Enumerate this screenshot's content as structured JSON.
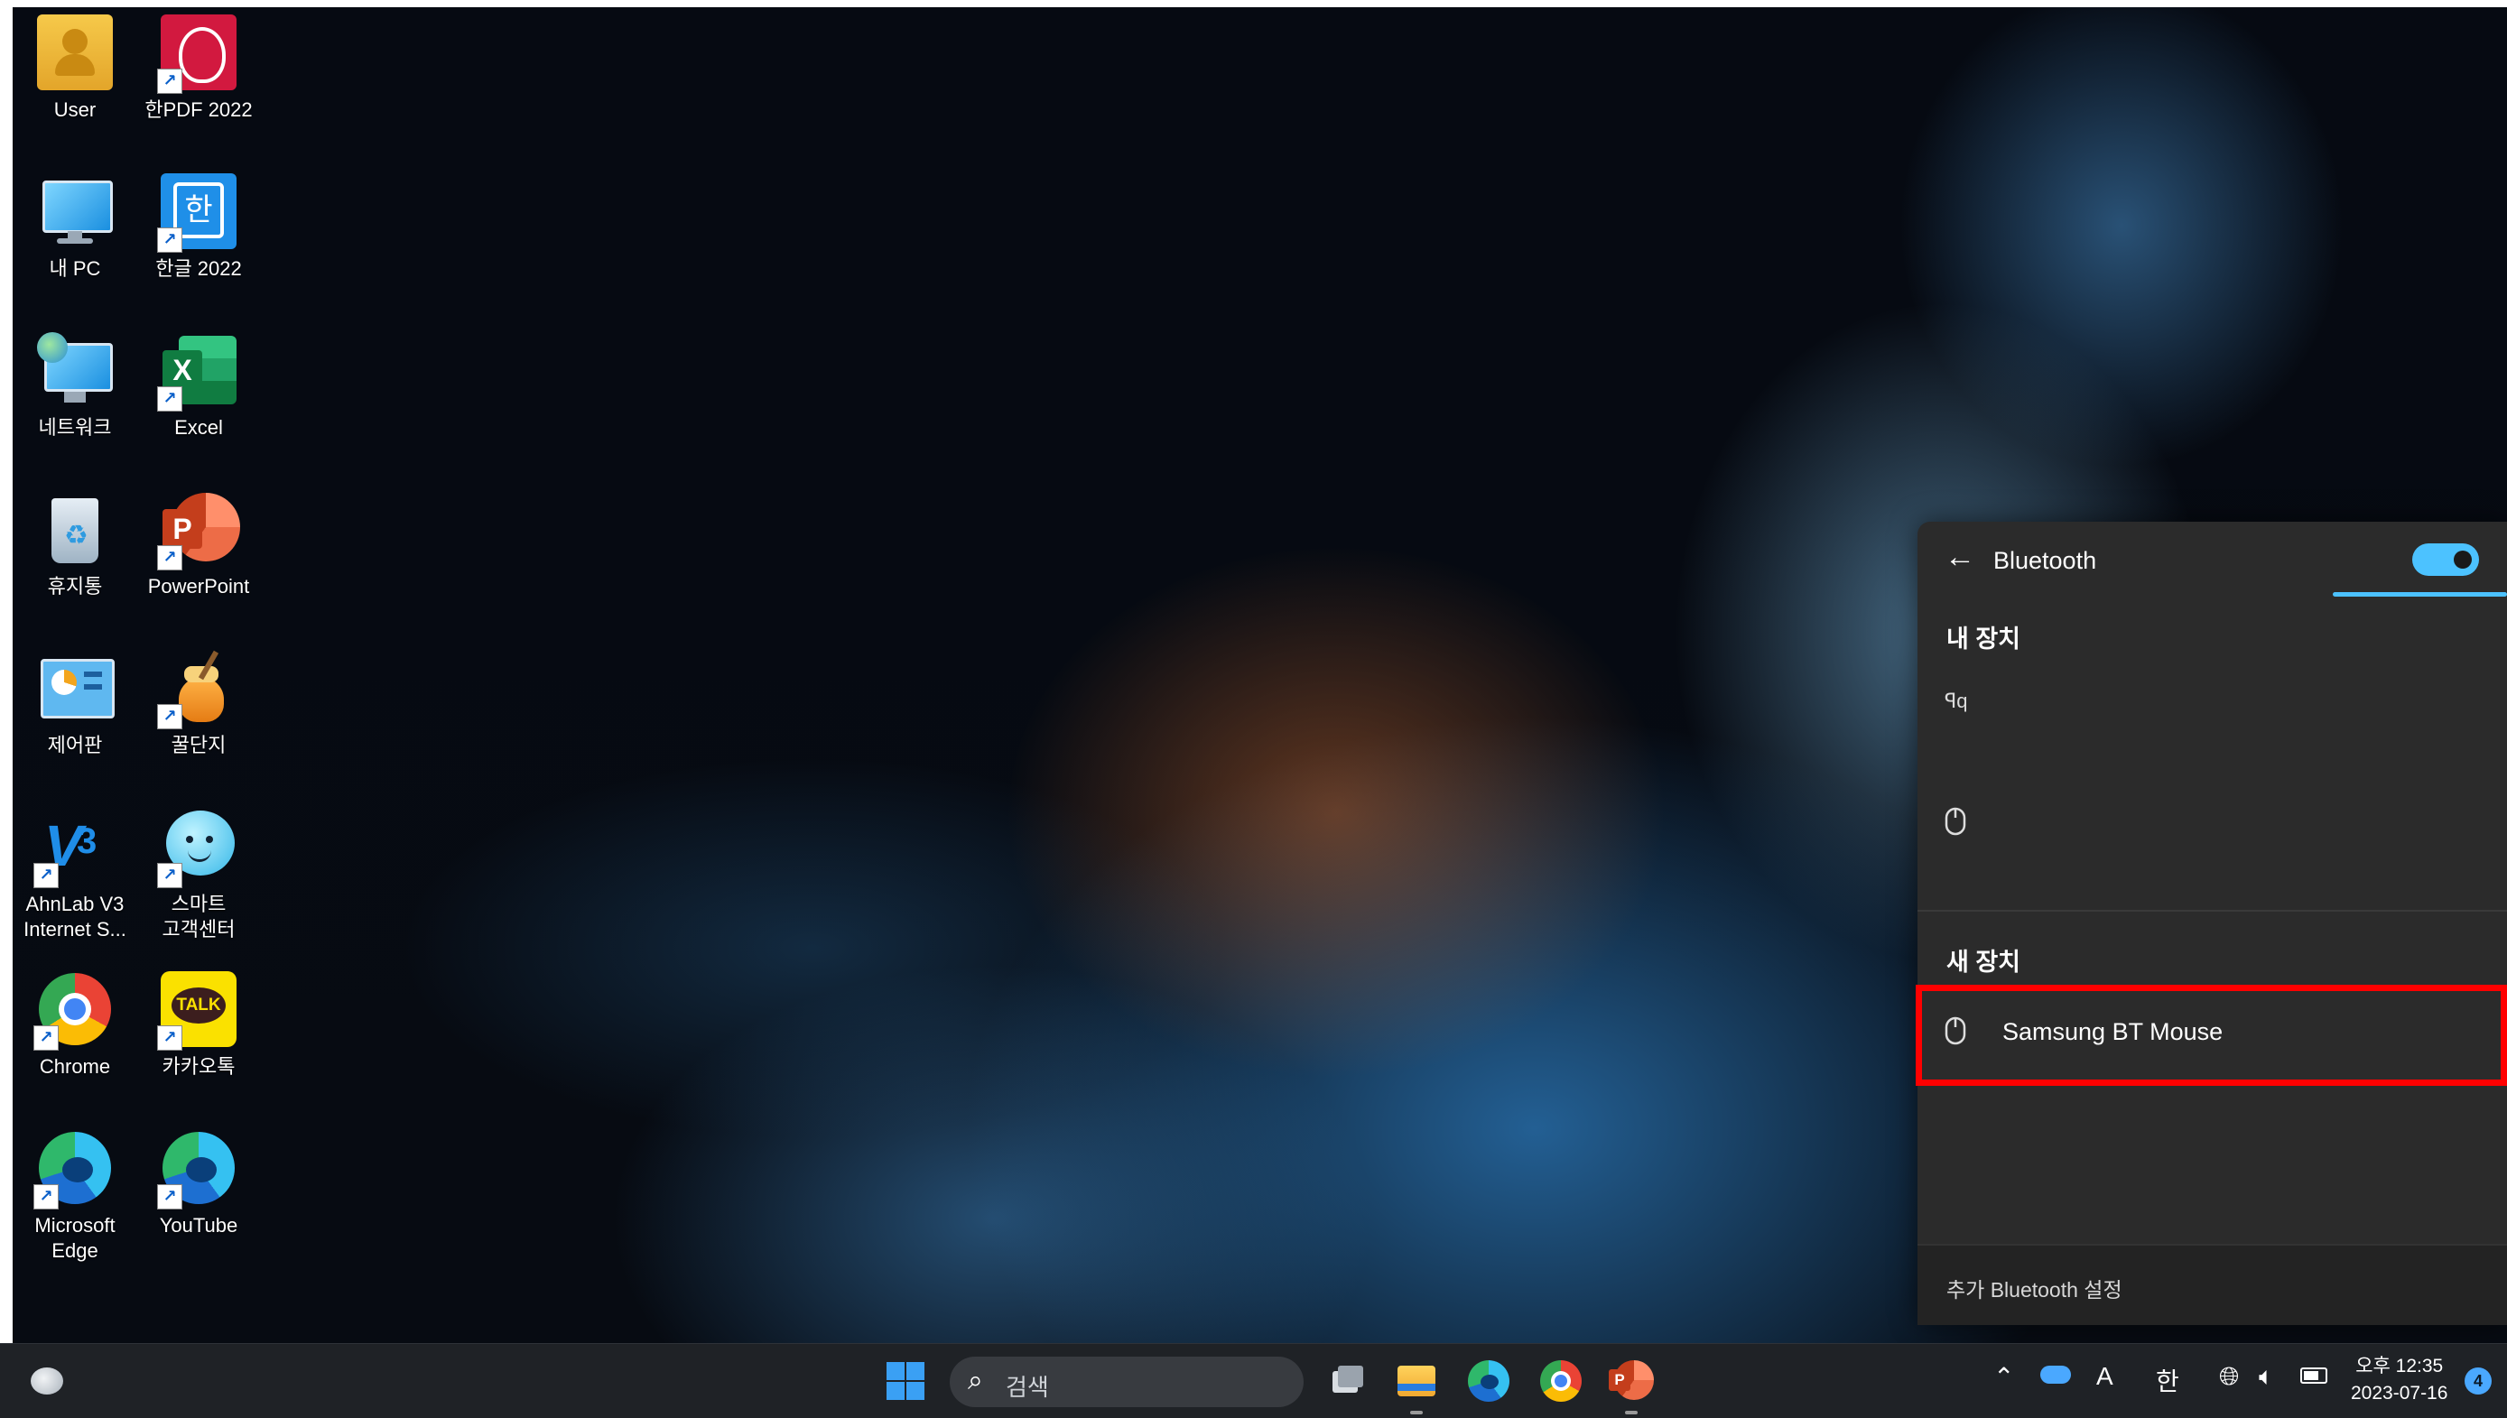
{
  "desktop_icons": [
    {
      "label": "User",
      "icon": "folder-user-icon"
    },
    {
      "label": "한PDF 2022",
      "icon": "hanpdf-icon"
    },
    {
      "label": "내 PC",
      "icon": "monitor-icon"
    },
    {
      "label": "한글 2022",
      "icon": "hangul-icon"
    },
    {
      "label": "네트워크",
      "icon": "network-icon"
    },
    {
      "label": "Excel",
      "icon": "excel-icon"
    },
    {
      "label": "휴지통",
      "icon": "recycle-bin-icon"
    },
    {
      "label": "PowerPoint",
      "icon": "powerpoint-icon"
    },
    {
      "label": "제어판",
      "icon": "control-panel-icon"
    },
    {
      "label": "꿀단지",
      "icon": "honey-pot-icon"
    },
    {
      "label": "AhnLab V3\nInternet S...",
      "line1": "AhnLab V3",
      "line2": "Internet S...",
      "icon": "ahnlab-icon"
    },
    {
      "label": "스마트\n고객센터",
      "line1": "스마트",
      "line2": "고객센터",
      "icon": "smart-support-icon"
    },
    {
      "label": "Chrome",
      "icon": "chrome-icon"
    },
    {
      "label": "카카오톡",
      "icon": "kakaotalk-icon"
    },
    {
      "label": "Microsoft\nEdge",
      "line1": "Microsoft",
      "line2": "Edge",
      "icon": "edge-icon"
    },
    {
      "label": "YouTube",
      "icon": "edge-youtube-icon"
    }
  ],
  "bluetooth_panel": {
    "title": "Bluetooth",
    "toggle_on": true,
    "my_devices_label": "내 장치",
    "my_devices": [
      {
        "icon": "unknown-device-icon",
        "glyph": "ꟼq",
        "name": ""
      },
      {
        "icon": "mouse-icon",
        "name": ""
      }
    ],
    "new_devices_label": "새 장치",
    "new_devices": [
      {
        "icon": "mouse-icon",
        "name": "Samsung BT Mouse"
      }
    ],
    "footer_link": "추가 Bluetooth 설정",
    "accent": "#4cc2ff",
    "highlight_color": "#ff0000"
  },
  "taskbar": {
    "search_placeholder": "검색",
    "ime_mode": "A",
    "ime_lang": "한",
    "time": "오후 12:35",
    "date": "2023-07-16",
    "notification_count": "4"
  }
}
